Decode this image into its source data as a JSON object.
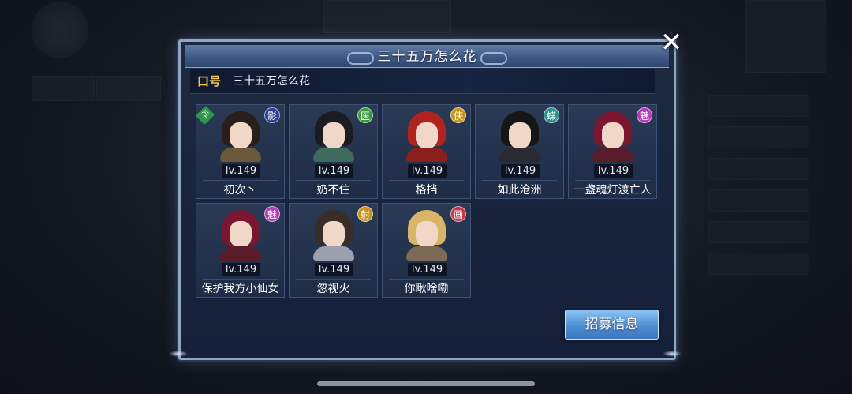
{
  "dialog": {
    "title": "三十五万怎么花",
    "slogan_label": "口号",
    "slogan_text": "三十五万怎么花",
    "recruit_button": "招募信息",
    "close_glyph": "✕"
  },
  "members": [
    {
      "name": "初次丶",
      "level": "lv.149",
      "badge": "影",
      "badge_color": "#2b3e8f",
      "hair": "#2b1d1a",
      "body": "#6b5a3a",
      "leader_badge": "令"
    },
    {
      "name": "奶不住",
      "level": "lv.149",
      "badge": "医",
      "badge_color": "#3a9a3e",
      "hair": "#1b1b22",
      "body": "#3e6b5b",
      "leader_badge": ""
    },
    {
      "name": "格挡",
      "level": "lv.149",
      "badge": "侠",
      "badge_color": "#c8961e",
      "hair": "#b0241f",
      "body": "#8a1f1c",
      "leader_badge": ""
    },
    {
      "name": "如此沧洲",
      "level": "lv.149",
      "badge": "蝶",
      "badge_color": "#2e8f8a",
      "hair": "#161616",
      "body": "#2a2a30",
      "leader_badge": ""
    },
    {
      "name": "一盏魂灯渡亡人",
      "level": "lv.149",
      "badge": "魅",
      "badge_color": "#b43cbc",
      "hair": "#7a1630",
      "body": "#5a1c2a",
      "leader_badge": ""
    },
    {
      "name": "保护我方小仙女",
      "level": "lv.149",
      "badge": "魅",
      "badge_color": "#b43cbc",
      "hair": "#7a1630",
      "body": "#5a1c2a",
      "leader_badge": ""
    },
    {
      "name": "忽视火",
      "level": "lv.149",
      "badge": "射",
      "badge_color": "#c8961e",
      "hair": "#3a2c26",
      "body": "#9aa0ad",
      "leader_badge": ""
    },
    {
      "name": "你瞅啥嘞",
      "level": "lv.149",
      "badge": "画",
      "badge_color": "#c23a4a",
      "hair": "#d9b56a",
      "body": "#7d6a55",
      "leader_badge": ""
    }
  ]
}
